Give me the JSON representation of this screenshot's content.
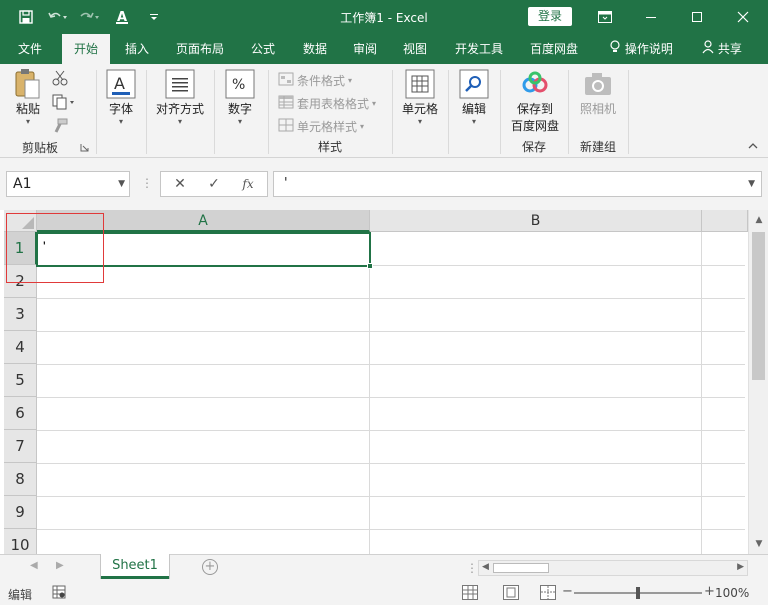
{
  "window": {
    "title": "工作簿1 - Excel",
    "login_label": "登录"
  },
  "tabs": [
    {
      "label": "文件",
      "active": false
    },
    {
      "label": "开始",
      "active": true
    },
    {
      "label": "插入",
      "active": false
    },
    {
      "label": "页面布局",
      "active": false
    },
    {
      "label": "公式",
      "active": false
    },
    {
      "label": "数据",
      "active": false
    },
    {
      "label": "审阅",
      "active": false
    },
    {
      "label": "视图",
      "active": false
    },
    {
      "label": "开发工具",
      "active": false
    },
    {
      "label": "百度网盘",
      "active": false
    }
  ],
  "tell_me": "操作说明",
  "share_label": "共享",
  "ribbon": {
    "clipboard": {
      "paste": "粘贴",
      "group": "剪贴板"
    },
    "font": {
      "label": "字体"
    },
    "alignment": {
      "label": "对齐方式"
    },
    "number": {
      "label": "数字"
    },
    "styles": {
      "conditional": "条件格式",
      "table": "套用表格格式",
      "cell": "单元格样式",
      "group": "样式"
    },
    "cells": {
      "label": "单元格"
    },
    "editing": {
      "label": "编辑"
    },
    "baidu": {
      "label_line1": "保存到",
      "label_line2": "百度网盘",
      "group": "保存"
    },
    "camera": {
      "label": "照相机",
      "group": "新建组"
    }
  },
  "formula_bar": {
    "name_box": "A1",
    "fx_label": "fx",
    "formula": "'"
  },
  "grid": {
    "columns": [
      "A",
      "B"
    ],
    "rows": [
      "1",
      "2",
      "3",
      "4",
      "5",
      "6",
      "7",
      "8",
      "9",
      "10"
    ],
    "active_cell": "A1",
    "a1_value": "'"
  },
  "sheets": [
    {
      "name": "Sheet1",
      "active": true
    }
  ],
  "status": {
    "mode": "编辑",
    "zoom": "100%"
  },
  "colors": {
    "accent": "#217346",
    "highlight_box": "#e03a3a"
  }
}
